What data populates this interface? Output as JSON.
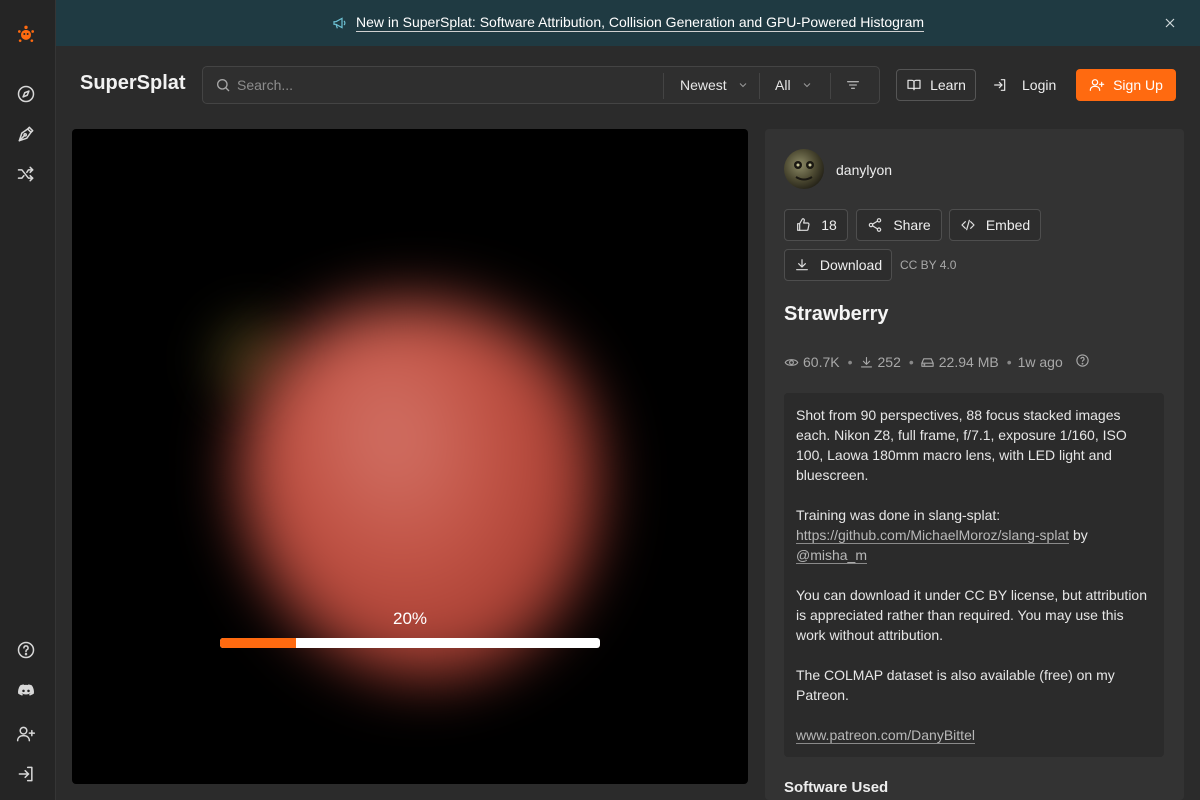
{
  "banner": {
    "text": "New in SuperSplat: Software Attribution, Collision Generation and GPU-Powered Histogram"
  },
  "header": {
    "brand": "SuperSplat",
    "search_placeholder": "Search...",
    "sort_value": "Newest",
    "filter_value": "All",
    "learn_label": "Learn",
    "login_label": "Login",
    "signup_label": "Sign Up"
  },
  "viewer": {
    "progress_text": "20%",
    "progress_value": 0.2
  },
  "panel": {
    "author": "danylyon",
    "likes": "18",
    "share_label": "Share",
    "embed_label": "Embed",
    "download_label": "Download",
    "license": "CC BY 4.0",
    "title": "Strawberry",
    "stats": {
      "views": "60.7K",
      "downloads": "252",
      "size": "22.94 MB",
      "age": "1w ago"
    },
    "description": {
      "p1": "Shot from 90 perspectives, 88 focus stacked images each. Nikon Z8, full frame, f/7.1, exposure 1/160, ISO 100, Laowa 180mm macro lens, with LED light and bluescreen.",
      "p2_prefix": "Training was done in slang-splat:",
      "p2_link": "https://github.com/MichaelMoroz/slang-splat",
      "p2_by": " by",
      "p2_user": "@misha_m",
      "p3": "You can download it under CC BY license, but attribution is appreciated rather than required. You may use this work without attribution.",
      "p4": "The COLMAP dataset is also available (free) on my Patreon.",
      "p5_link": "www.patreon.com/DanyBittel"
    },
    "software_heading": "Software Used"
  },
  "icons": {
    "logo": "supersplat-logo-icon",
    "explore": "compass-icon",
    "editor": "pen-nib-icon",
    "random": "shuffle-icon",
    "help": "help-circle-icon",
    "discord": "discord-icon",
    "invite": "user-plus-icon",
    "login": "login-icon"
  },
  "colors": {
    "accent": "#ff6a10",
    "banner_bg": "#1f3a42"
  }
}
